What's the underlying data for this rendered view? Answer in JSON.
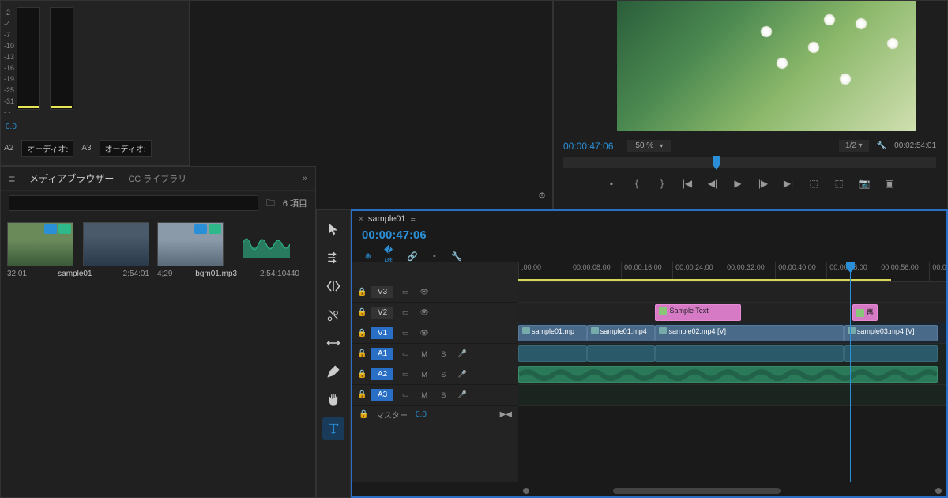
{
  "audio_meters": {
    "scale": [
      "-2",
      "-4",
      "-7",
      "-10",
      "-13",
      "-16",
      "-19",
      "-25",
      "-31",
      "- -"
    ],
    "current_value": "0.0",
    "track_refs": [
      {
        "code": "A2",
        "label": "オーディオ:"
      },
      {
        "code": "A3",
        "label": "オーディオ:"
      }
    ]
  },
  "monitor": {
    "timecode": "00:00:47:06",
    "zoom": "50 %",
    "ratio": "1/2",
    "duration": "00:02:54:01"
  },
  "media_browser": {
    "title": "メディアブラウザー",
    "tab_cc": "CC ライブラリ",
    "item_count": "6 項目",
    "items": [
      {
        "name": "",
        "duration": "32:01",
        "type": "video"
      },
      {
        "name": "sample01",
        "duration": "2:54:01",
        "type": "video"
      },
      {
        "name": "",
        "duration": "4;29",
        "type": "video"
      },
      {
        "name": "bgm01.mp3",
        "duration": "2:54:10440",
        "type": "audio"
      }
    ]
  },
  "timeline": {
    "sequence_name": "sample01",
    "timecode": "00:00:47:06",
    "ruler_ticks": [
      ";00:00",
      "00:00:08:00",
      "00:00:16:00",
      "00:00:24:00",
      "00:00:32:00",
      "00:00:40:00",
      "00:00:48:00",
      "00:00:56:00",
      "00:0"
    ],
    "tracks": {
      "video": [
        {
          "name": "V3",
          "locked": false
        },
        {
          "name": "V2",
          "locked": false
        },
        {
          "name": "V1",
          "locked": false,
          "selected": true
        }
      ],
      "audio": [
        {
          "name": "A1",
          "locked": false,
          "selected": true
        },
        {
          "name": "A2",
          "locked": false,
          "selected": true
        },
        {
          "name": "A3",
          "locked": false,
          "selected": true
        }
      ]
    },
    "master_label": "マスター",
    "master_value": "0.0",
    "clips": {
      "v2_text1": "Sample Text",
      "v2_text2": "再",
      "v1_clip1": "sample01.mp",
      "v1_clip2": "sample01.mp4",
      "v1_clip3": "sample02.mp4 [V]",
      "v1_clip4": "sample03.mp4 [V]"
    }
  }
}
